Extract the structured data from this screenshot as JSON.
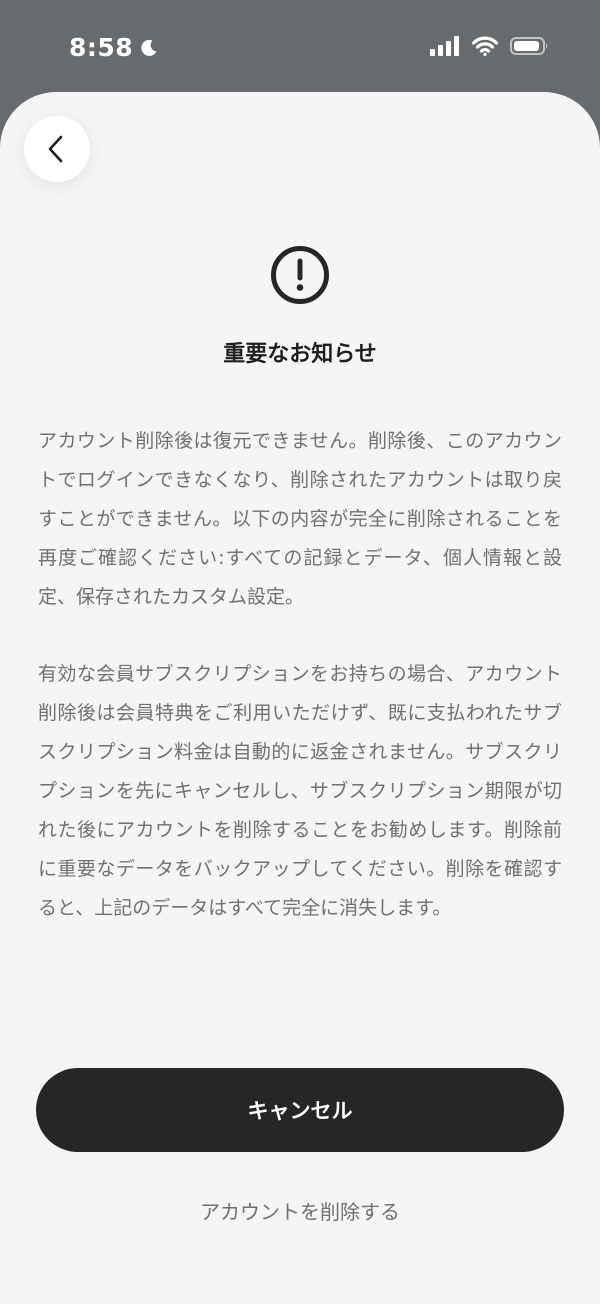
{
  "status_bar": {
    "time": "8:58",
    "icons": [
      "moon-icon",
      "signal-icon",
      "wifi-icon",
      "battery-icon"
    ]
  },
  "notice": {
    "title": "重要なお知らせ",
    "paragraphs": [
      "アカウント削除後は復元できません。削除後、このアカウントでログインできなくなり、削除されたアカウントは取り戻すことができません。以下の内容が完全に削除されることを再度ご確認ください:すべての記録とデータ、個人情報と設定、保存されたカスタム設定。",
      "有効な会員サブスクリプションをお持ちの場合、アカウント削除後は会員特典をご利用いただけず、既に支払われたサブスクリプション料金は自動的に返金されません。サブスクリプションを先にキャンセルし、サブスクリプション期限が切れた後にアカウントを削除することをお勧めします。削除前に重要なデータをバックアップしてください。削除を確認すると、上記のデータはすべて完全に消失します。"
    ]
  },
  "actions": {
    "cancel_label": "キャンセル",
    "delete_label": "アカウントを削除する"
  },
  "colors": {
    "status_background": "#686b6d",
    "sheet_background": "#f5f5f7",
    "primary_button": "#262626",
    "body_text": "#707070",
    "title_text": "#1f1f1f"
  }
}
